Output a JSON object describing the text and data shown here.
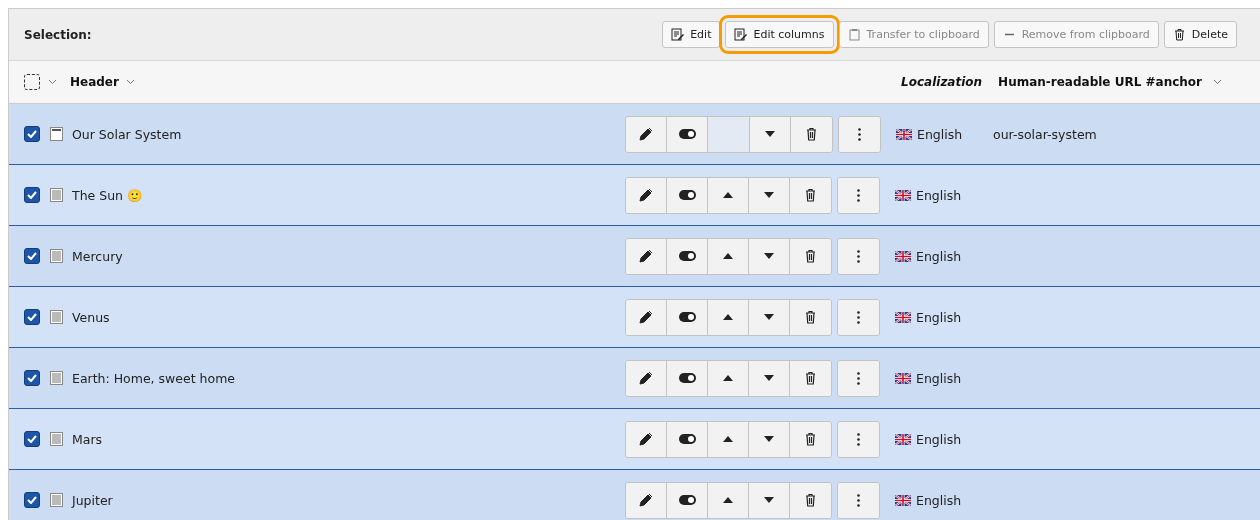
{
  "toolbar": {
    "label": "Selection:",
    "buttons": [
      {
        "kind": "edit",
        "label": "Edit",
        "disabled": false,
        "highlighted": false
      },
      {
        "kind": "edit",
        "label": "Edit columns",
        "disabled": false,
        "highlighted": true
      },
      {
        "kind": "clipboard",
        "label": "Transfer to clipboard",
        "disabled": true,
        "highlighted": false
      },
      {
        "kind": "minus",
        "label": "Remove from clipboard",
        "disabled": true,
        "highlighted": false
      },
      {
        "kind": "delete",
        "label": "Delete",
        "disabled": false,
        "highlighted": false
      }
    ]
  },
  "columns": {
    "header": "Header",
    "localization": "Localization",
    "url": "Human-readable URL #anchor",
    "select_all_checked": false
  },
  "rows": [
    {
      "title": "Our Solar System",
      "kind": "header",
      "checked": true,
      "can_move_up": false,
      "language": "English",
      "url": "our-solar-system"
    },
    {
      "title": "The Sun 🙂",
      "kind": "text",
      "checked": true,
      "can_move_up": true,
      "language": "English"
    },
    {
      "title": "Mercury",
      "kind": "text",
      "checked": true,
      "can_move_up": true,
      "language": "English"
    },
    {
      "title": "Venus",
      "kind": "text",
      "checked": true,
      "can_move_up": true,
      "language": "English"
    },
    {
      "title": "Earth: Home, sweet home",
      "kind": "text",
      "checked": true,
      "can_move_up": true,
      "language": "English"
    },
    {
      "title": "Mars",
      "kind": "text",
      "checked": true,
      "can_move_up": true,
      "language": "English"
    },
    {
      "title": "Jupiter",
      "kind": "text",
      "checked": true,
      "can_move_up": true,
      "language": "English"
    }
  ]
}
